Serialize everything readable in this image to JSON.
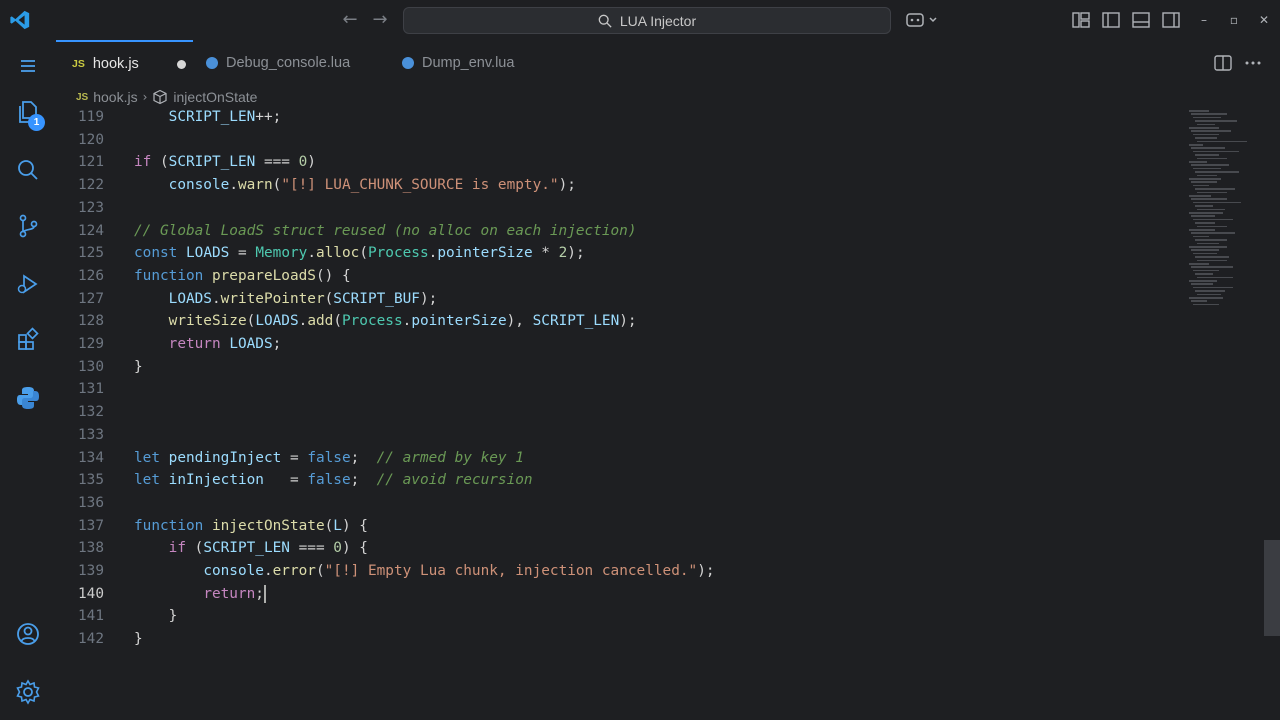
{
  "titlebar": {
    "search_text": "LUA Injector"
  },
  "activity": {
    "explorer_badge": "1"
  },
  "tabs": [
    {
      "label": "hook.js",
      "type": "js",
      "active": true,
      "dirty": true
    },
    {
      "label": "Debug_console.lua",
      "type": "lua",
      "active": false,
      "dirty": false
    },
    {
      "label": "Dump_env.lua",
      "type": "lua",
      "active": false,
      "dirty": false
    }
  ],
  "breadcrumb": {
    "file": "hook.js",
    "symbol": "injectOnState",
    "js_badge": "JS"
  },
  "editor": {
    "current_line": 140,
    "lines": [
      {
        "n": "119",
        "code": "    SCRIPT_LEN++;"
      },
      {
        "n": "120",
        "code": ""
      },
      {
        "n": "121",
        "code": "if (SCRIPT_LEN === 0)"
      },
      {
        "n": "122",
        "code": "    console.warn(\"[!] LUA_CHUNK_SOURCE is empty.\");"
      },
      {
        "n": "123",
        "code": ""
      },
      {
        "n": "124",
        "code": "// Global LoadS struct reused (no alloc on each injection)"
      },
      {
        "n": "125",
        "code": "const LOADS = Memory.alloc(Process.pointerSize * 2);"
      },
      {
        "n": "126",
        "code": "function prepareLoadS() {"
      },
      {
        "n": "127",
        "code": "    LOADS.writePointer(SCRIPT_BUF);"
      },
      {
        "n": "128",
        "code": "    writeSize(LOADS.add(Process.pointerSize), SCRIPT_LEN);"
      },
      {
        "n": "129",
        "code": "    return LOADS;"
      },
      {
        "n": "130",
        "code": "}"
      },
      {
        "n": "131",
        "code": ""
      },
      {
        "n": "132",
        "code": ""
      },
      {
        "n": "133",
        "code": ""
      },
      {
        "n": "134",
        "code": "let pendingInject = false;  // armed by key 1"
      },
      {
        "n": "135",
        "code": "let inInjection   = false;  // avoid recursion"
      },
      {
        "n": "136",
        "code": ""
      },
      {
        "n": "137",
        "code": "function injectOnState(L) {"
      },
      {
        "n": "138",
        "code": "    if (SCRIPT_LEN === 0) {"
      },
      {
        "n": "139",
        "code": "        console.error(\"[!] Empty Lua chunk, injection cancelled.\");"
      },
      {
        "n": "140",
        "code": "        return;"
      },
      {
        "n": "141",
        "code": "    }"
      },
      {
        "n": "142",
        "code": "}"
      }
    ]
  },
  "colors": {
    "accent": "#3794ff",
    "background": "#1e1f22"
  }
}
